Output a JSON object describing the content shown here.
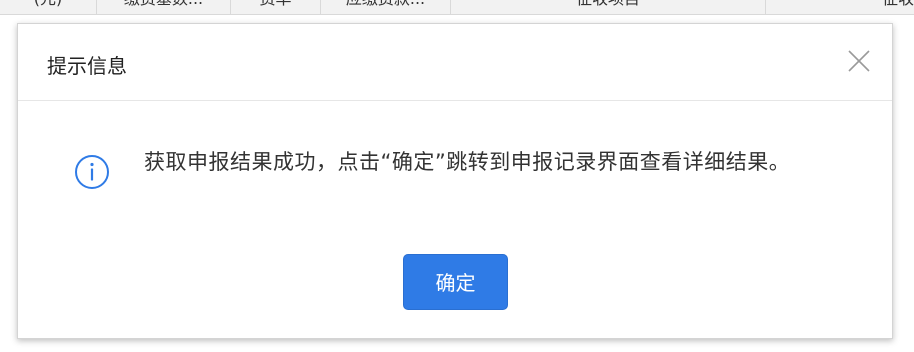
{
  "background_table": {
    "columns": [
      "(元)",
      "缴费基数...",
      "费率",
      "应缴费款...",
      "征收项目",
      "征收"
    ]
  },
  "dialog": {
    "title": "提示信息",
    "message": "获取申报结果成功，点击“确定”跳转到申报记录界面查看详细结果。",
    "confirm_label": "确定",
    "close_icon": "close-icon",
    "info_icon": "info-circle-icon"
  },
  "colors": {
    "accent": "#2f7be6",
    "info_icon": "#2f7be6"
  }
}
